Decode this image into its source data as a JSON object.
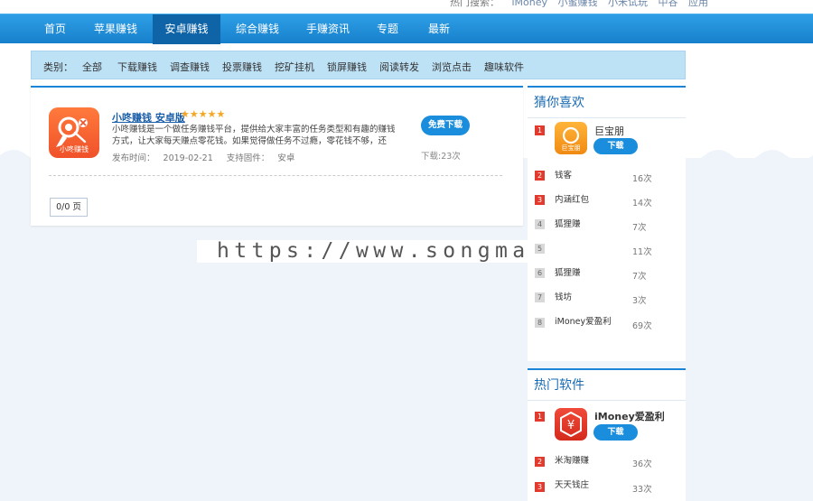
{
  "topbar": {
    "label": "热门搜索：",
    "links": [
      "iMoney",
      "小蜜赚钱",
      "小米试玩",
      "中谷",
      "应用"
    ]
  },
  "nav": {
    "items": [
      "首页",
      "苹果赚钱",
      "安卓赚钱",
      "综合赚钱",
      "手赚资讯",
      "专题",
      "最新"
    ],
    "active_index": 2
  },
  "subnav": {
    "label": "类别：",
    "items": [
      "全部",
      "下载赚钱",
      "调查赚钱",
      "投票赚钱",
      "挖矿挂机",
      "锁屏赚钱",
      "阅读转发",
      "浏览点击",
      "趣味软件"
    ]
  },
  "app": {
    "icon_caption": "小咚赚钱",
    "title": "小咚赚钱 安卓版",
    "stars": "★★★★★",
    "rating": 5,
    "description": "小咚赚钱是一个做任务赚钱平台，提供给大家丰富的任务类型和有趣的赚钱方式，让大家每天赚点零花钱。如果觉得做任务不过瘾，零花钱不够，还",
    "date_label": "发布时间：",
    "date": "2019-02-21",
    "firmware_label": "支持固件：",
    "firmware": "安卓",
    "download_button": "免费下载",
    "download_count": "下载:23次"
  },
  "pager": {
    "text": "0/0 页"
  },
  "watermark": {
    "text": "https://www.songma.com"
  },
  "guess": {
    "title": "猜你喜欢",
    "featured": {
      "rank": "1",
      "name": "巨宝朋",
      "icon_caption": "巨宝朋",
      "button": "下载"
    },
    "items": [
      {
        "rank": "2",
        "name": "钱客",
        "count": "16次"
      },
      {
        "rank": "3",
        "name": "内涵红包",
        "count": "14次"
      },
      {
        "rank": "4",
        "name": "狐狸赚",
        "count": "7次"
      },
      {
        "rank": "5",
        "name": "",
        "count": "11次"
      },
      {
        "rank": "6",
        "name": "狐狸赚",
        "count": "7次"
      },
      {
        "rank": "7",
        "name": "钱坊",
        "count": "3次"
      },
      {
        "rank": "8",
        "name": "iMoney爱盈利",
        "count": "69次"
      }
    ]
  },
  "hot": {
    "title": "热门软件",
    "featured": {
      "rank": "1",
      "name": "iMoney爱盈利",
      "button": "下载"
    },
    "items": [
      {
        "rank": "2",
        "name": "米淘赚赚",
        "count": "36次"
      },
      {
        "rank": "3",
        "name": "天天钱庄",
        "count": "33次"
      }
    ]
  },
  "colors": {
    "nav_blue": "#1780cc",
    "nav_active": "#0f64a8",
    "subnav_bg": "#bde1f5",
    "button_blue": "#1a8ddc",
    "rank_red": "#e23b2e",
    "star_gold": "#f5a623",
    "app_icon_orange": "#f0512a"
  },
  "icons": {
    "app_icon": "xiaodong-app-icon",
    "featured_guess_icon": "jubaopeng-app-icon",
    "featured_hot_icon": "yuan-shield-app-icon"
  }
}
